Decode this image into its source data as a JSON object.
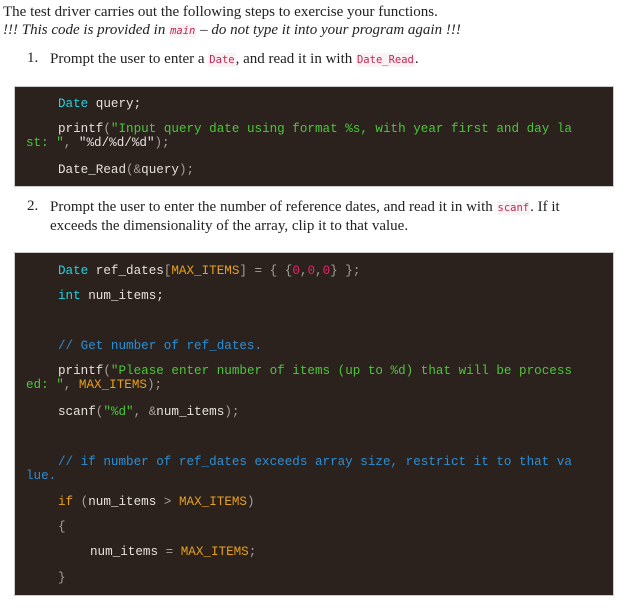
{
  "intro": {
    "line1": "The test driver carries out the following steps to exercise your functions.",
    "warning_pre": "!!! This code is provided in ",
    "warning_code": "main",
    "warning_post": " – do not type it into your program again !!!"
  },
  "steps": [
    {
      "number": "1.",
      "parts": [
        "Prompt the user to enter a ",
        "Date",
        ", and read it in with ",
        "Date_Read",
        "."
      ]
    },
    {
      "number": "2.",
      "line1_pre": "Prompt the user to enter the number of reference dates, and read it in with ",
      "line1_code": "scanf",
      "line1_post": ". If it",
      "line2": "exceeds the dimensionality of the array, clip it to that value."
    }
  ],
  "code_block_1": {
    "l1_type": "Date",
    "l1_rest": " query;",
    "l2_fn": "printf",
    "l2_paren": "(",
    "l2_str": "\"Input query date using format %s, with year first and day la",
    "l3_str": "st: \"",
    "l3_comma": ", ",
    "l3_str2": "\"%d/%d/%d\"",
    "l3_end": ");",
    "l4_fn": "Date_Read",
    "l4_paren": "(",
    "l4_amp": "&",
    "l4_arg": "query",
    "l4_end": ");"
  },
  "code_block_2": {
    "l1_type": "Date",
    "l1_var": " ref_dates",
    "l1_lb": "[",
    "l1_macro": "MAX_ITEMS",
    "l1_rb": "]",
    "l1_eq": " = { {",
    "l1_n1": "0",
    "l1_c1": ",",
    "l1_n2": "0",
    "l1_c2": ",",
    "l1_n3": "0",
    "l1_end": "} };",
    "l2_type": "int",
    "l2_rest": " num_items;",
    "l3_comment": "// Get number of ref_dates.",
    "l4_fn": "printf",
    "l4_paren": "(",
    "l4_str": "\"Please enter number of items (up to %d) that will be process",
    "l5_str": "ed: \"",
    "l5_comma": ", ",
    "l5_macro": "MAX_ITEMS",
    "l5_end": ");",
    "l6_fn": "scanf",
    "l6_paren": "(",
    "l6_str": "\"%d\"",
    "l6_comma": ", ",
    "l6_amp": "&",
    "l6_arg": "num_items",
    "l6_end": ");",
    "l7_comment": "// if number of ref_dates exceeds array size, restrict it to that va",
    "l8_comment": "lue.",
    "l9_kw": "if",
    "l9_open": " (",
    "l9_var": "num_items",
    "l9_gt": " > ",
    "l9_macro": "MAX_ITEMS",
    "l9_close": ")",
    "l10_brace": "{",
    "l11_var": "num_items",
    "l11_eq": " = ",
    "l11_macro": "MAX_ITEMS",
    "l11_end": ";",
    "l12_brace": "}"
  }
}
